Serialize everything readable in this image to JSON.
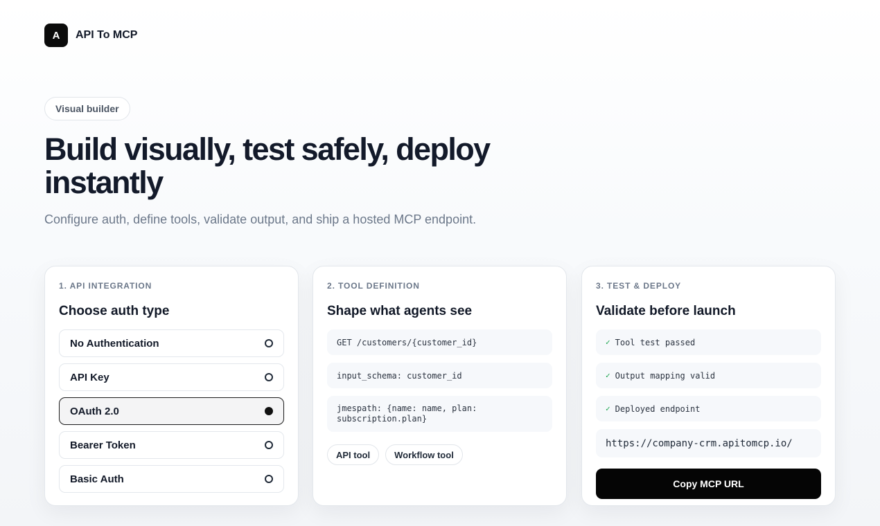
{
  "brand": {
    "logo_letter": "A",
    "name": "API To MCP"
  },
  "hero": {
    "badge": "Visual builder",
    "headline": "Build visually, test safely, deploy instantly",
    "subtitle": "Configure auth, define tools, validate output, and ship a hosted MCP endpoint."
  },
  "cards": {
    "integration": {
      "step": "1. API INTEGRATION",
      "title": "Choose auth type",
      "options": [
        {
          "label": "No Authentication",
          "selected": false
        },
        {
          "label": "API Key",
          "selected": false
        },
        {
          "label": "OAuth 2.0",
          "selected": true
        },
        {
          "label": "Bearer Token",
          "selected": false
        },
        {
          "label": "Basic Auth",
          "selected": false
        }
      ]
    },
    "tool": {
      "step": "2. TOOL DEFINITION",
      "title": "Shape what agents see",
      "code_lines": [
        "GET /customers/{customer_id}",
        "input_schema: customer_id",
        "jmespath: {name: name, plan: subscription.plan}"
      ],
      "chips": [
        "API tool",
        "Workflow tool"
      ]
    },
    "deploy": {
      "step": "3. TEST & DEPLOY",
      "title": "Validate before launch",
      "checks": [
        "Tool test passed",
        "Output mapping valid",
        "Deployed endpoint"
      ],
      "check_mark": "✓",
      "url": "https://company-crm.apitomcp.io/",
      "copy_label": "Copy MCP URL"
    }
  },
  "colors": {
    "primary": "#050505",
    "text": "#111827",
    "muted": "#6b7789",
    "success": "#16a34a"
  }
}
